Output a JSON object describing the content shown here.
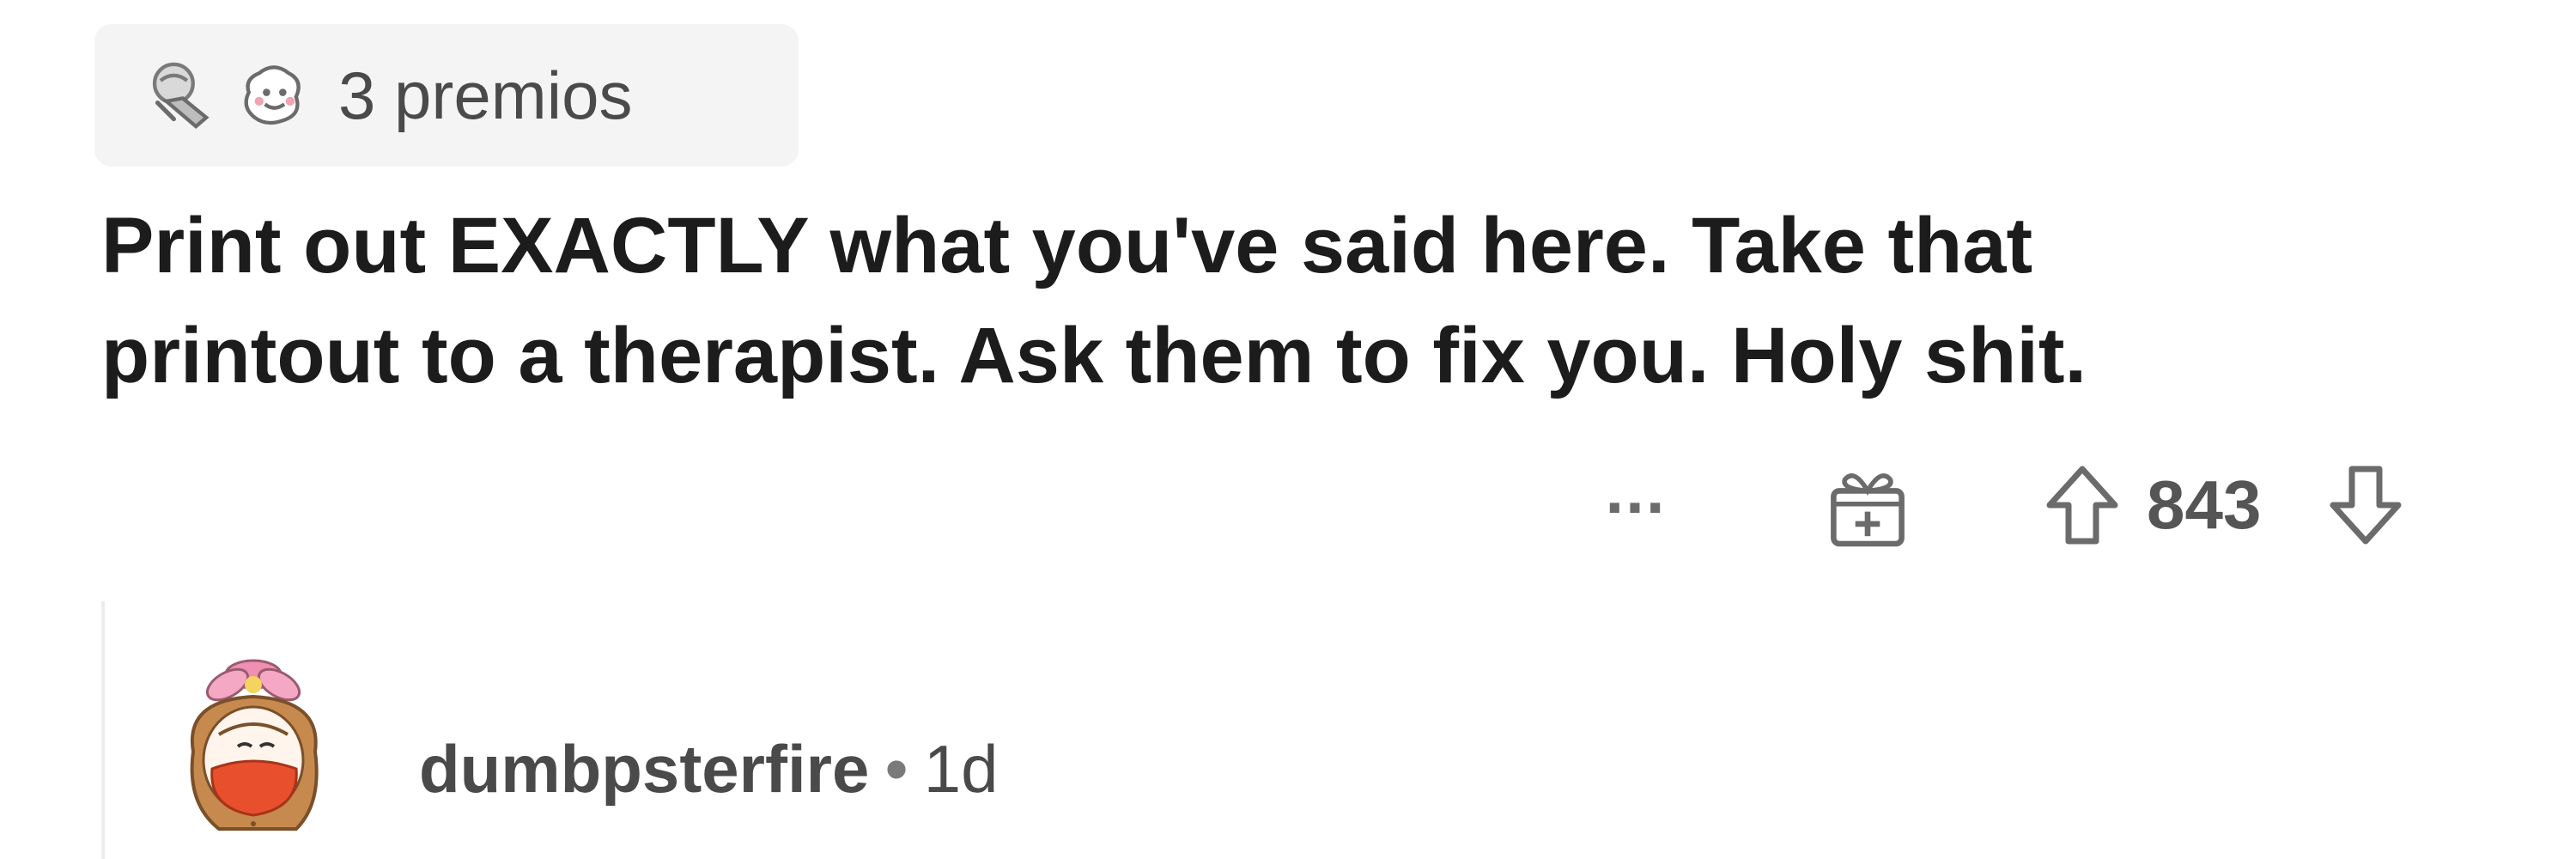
{
  "comment": {
    "awards": {
      "icons": [
        "silver-award-icon",
        "wholesome-award-icon"
      ],
      "count_label": "3 premios"
    },
    "body_lines": [
      "Print out EXACTLY what you've said here. Take that",
      "printout to a therapist. Ask them to fix you. Holy shit."
    ],
    "actions": {
      "more_label": "...",
      "gift_icon": "gift-icon",
      "upvote_icon": "upvote-arrow-icon",
      "score": "843",
      "downvote_icon": "downvote-arrow-icon"
    }
  },
  "reply": {
    "avatar_icon": "avatar-girl-with-flower-icon",
    "username": "dumbpsterfire",
    "separator": "•",
    "time": "1d"
  },
  "colors": {
    "text": "#1c1c1c",
    "muted": "#4a4a4a",
    "pill_bg": "#f4f4f4",
    "mask_red": "#e8502d",
    "flower_pink": "#ef8fb2"
  }
}
